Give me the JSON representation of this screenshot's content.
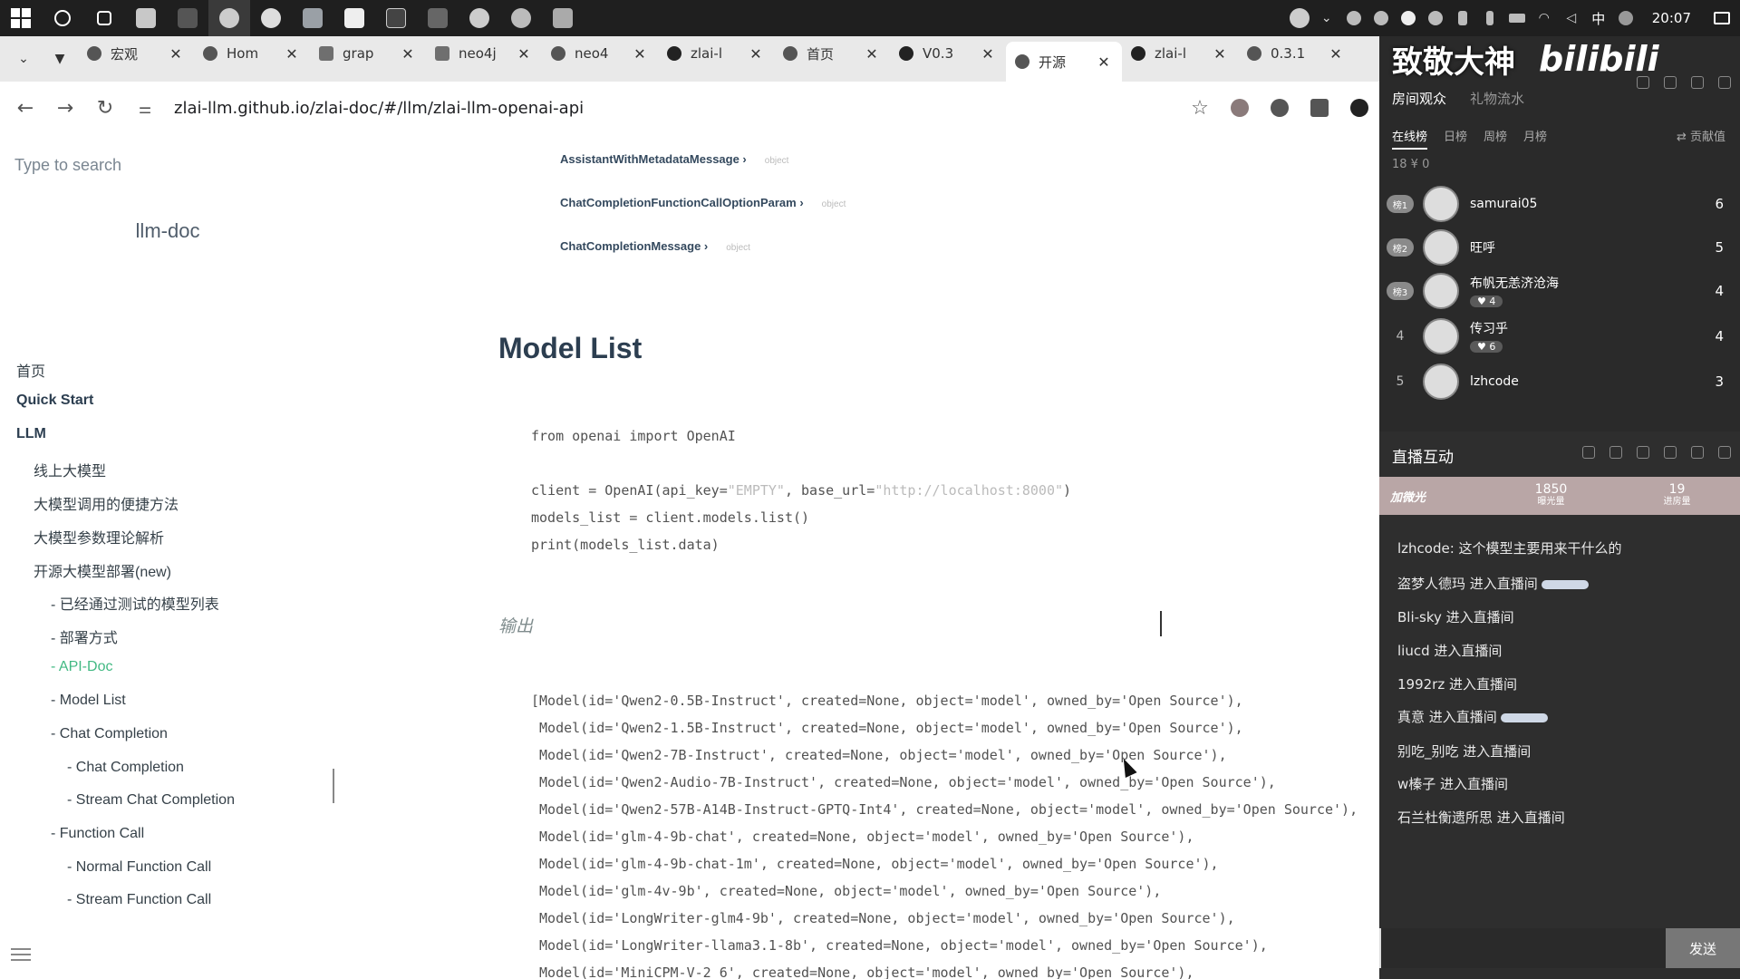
{
  "taskbar": {
    "apps": [
      "start-icon",
      "search-icon",
      "task-view-icon",
      "file-explorer-icon",
      "terminal-icon",
      "obs-icon",
      "wechat-icon",
      "app-icon",
      "vscode-icon",
      "pycharm-icon",
      "app-icon-2",
      "chrome-icon",
      "app-icon-3",
      "app-icon-4"
    ],
    "tray": [
      "user-avatar-icon",
      "chevron-up-icon",
      "tray-app-icon",
      "tray-app-icon-2",
      "f-icon",
      "cloud-icon",
      "bluetooth-icon",
      "mic-icon",
      "battery-icon",
      "wifi-icon",
      "volume-icon"
    ],
    "ime": "中",
    "clock": "20:07"
  },
  "tabs": [
    {
      "label": "宏观",
      "icon": "globe-icon"
    },
    {
      "label": "Hom",
      "icon": "loading-icon"
    },
    {
      "label": "grap",
      "icon": "neo4j-icon"
    },
    {
      "label": "neo4j",
      "icon": "neo4j-icon"
    },
    {
      "label": "neo4",
      "icon": "terminal-icon"
    },
    {
      "label": "zlai-l",
      "icon": "github-icon"
    },
    {
      "label": "首页",
      "icon": "globe-icon"
    },
    {
      "label": "V0.3",
      "icon": "github-icon"
    },
    {
      "label": "开源",
      "icon": "globe-icon",
      "active": true
    },
    {
      "label": "zlai-l",
      "icon": "github-icon"
    },
    {
      "label": "0.3.1",
      "icon": "loading-icon"
    }
  ],
  "address": {
    "url": "zlai-llm.github.io/zlai-doc/#/llm/zlai-llm-openai-api"
  },
  "sidebar": {
    "search_placeholder": "Type to search",
    "title": "llm-doc",
    "items": [
      {
        "label": "首页",
        "level": 0,
        "bold": false
      },
      {
        "label": "Quick Start",
        "level": 0,
        "bold": true
      },
      {
        "label": "LLM",
        "level": 0,
        "bold": true
      },
      {
        "label": "线上大模型",
        "level": 1
      },
      {
        "label": "大模型调用的便捷方法",
        "level": 1
      },
      {
        "label": "大模型参数理论解析",
        "level": 1
      },
      {
        "label": "开源大模型部署(new)",
        "level": 1
      },
      {
        "label": "- 已经通过测试的模型列表",
        "level": 2
      },
      {
        "label": "- 部署方式",
        "level": 2
      },
      {
        "label": "- API-Doc",
        "level": 2,
        "current": true
      },
      {
        "label": "- Model List",
        "level": 2
      },
      {
        "label": "- Chat Completion",
        "level": 2
      },
      {
        "label": "- Chat Completion",
        "level": 3
      },
      {
        "label": "- Stream Chat Completion",
        "level": 3
      },
      {
        "label": "- Function Call",
        "level": 2
      },
      {
        "label": "- Normal Function Call",
        "level": 3
      },
      {
        "label": "- Stream Function Call",
        "level": 3
      }
    ]
  },
  "content": {
    "object_lines": [
      {
        "name": "AssistantWithMetadataMessage ›",
        "type": "object"
      },
      {
        "name": "ChatCompletionFunctionCallOptionParam ›",
        "type": "object"
      },
      {
        "name": "ChatCompletionMessage ›",
        "type": "object"
      }
    ],
    "heading": "Model List",
    "code1": {
      "line1": "from openai import OpenAI",
      "line2a": "client = OpenAI(api_key=",
      "line2b": "\"EMPTY\"",
      "line2c": ", base_url=",
      "line2d": "\"http://localhost:8000\"",
      "line2e": ")",
      "line3": "models_list = client.models.list()",
      "line4": "print(models_list.data)"
    },
    "output_label": "输出",
    "output_lines": [
      "[Model(id='Qwen2-0.5B-Instruct', created=None, object='model', owned_by='Open Source'),",
      " Model(id='Qwen2-1.5B-Instruct', created=None, object='model', owned_by='Open Source'),",
      " Model(id='Qwen2-7B-Instruct', created=None, object='model', owned_by='Open Source'),",
      " Model(id='Qwen2-Audio-7B-Instruct', created=None, object='model', owned_by='Open Source'),",
      " Model(id='Qwen2-57B-A14B-Instruct-GPTQ-Int4', created=None, object='model', owned_by='Open Source'),",
      " Model(id='glm-4-9b-chat', created=None, object='model', owned_by='Open Source'),",
      " Model(id='glm-4-9b-chat-1m', created=None, object='model', owned_by='Open Source'),",
      " Model(id='glm-4v-9b', created=None, object='model', owned_by='Open Source'),",
      " Model(id='LongWriter-glm4-9b', created=None, object='model', owned_by='Open Source'),",
      " Model(id='LongWriter-llama3.1-8b', created=None, object='model', owned_by='Open Source'),",
      " Model(id='MiniCPM-V-2_6', created=None, object='model', owned_by='Open Source'),"
    ]
  },
  "bili": {
    "banner_left": "致敬大神",
    "banner_right": "bilibili",
    "tabs": [
      "房间观众",
      "礼物流水"
    ],
    "subtabs": [
      "在线榜",
      "日榜",
      "周榜",
      "月榜"
    ],
    "contrib_label": "⇄ 贡献值",
    "counts": "18  ¥ 0",
    "ranking": [
      {
        "rank": "榜1",
        "name": "samurai05",
        "score": "6",
        "badge": true
      },
      {
        "rank": "榜2",
        "name": "旺呼",
        "score": "5",
        "badge": true
      },
      {
        "rank": "榜3",
        "name": "布帆无恙济沧海",
        "sub": "♥ 4",
        "score": "4",
        "badge": true
      },
      {
        "rank": "4",
        "name": "传习乎",
        "sub": "♥ 6",
        "score": "4",
        "badge": false
      },
      {
        "rank": "5",
        "name": "lzhcode",
        "score": "3",
        "badge": false
      }
    ],
    "interact_title": "直播互动",
    "glow_label": "加微光",
    "stat1_value": "1850",
    "stat1_label": "曝光量",
    "stat2_value": "19",
    "stat2_label": "进房量",
    "messages": [
      {
        "text": "lzhcode: 这个模型主要用来干什么的",
        "tag": false
      },
      {
        "text": "盗梦人德玛 进入直播间",
        "tag": true
      },
      {
        "text": "Bli-sky 进入直播间",
        "tag": false
      },
      {
        "text": "liucd 进入直播间",
        "tag": false
      },
      {
        "text": "1992rz 进入直播间",
        "tag": false
      },
      {
        "text": "真意 进入直播间",
        "tag": true
      },
      {
        "text": "别吃_别吃 进入直播间",
        "tag": false
      },
      {
        "text": "w榛子 进入直播间",
        "tag": false
      },
      {
        "text": "石兰杜衡遗所思 进入直播间",
        "tag": false
      }
    ],
    "send_label": "发送"
  }
}
